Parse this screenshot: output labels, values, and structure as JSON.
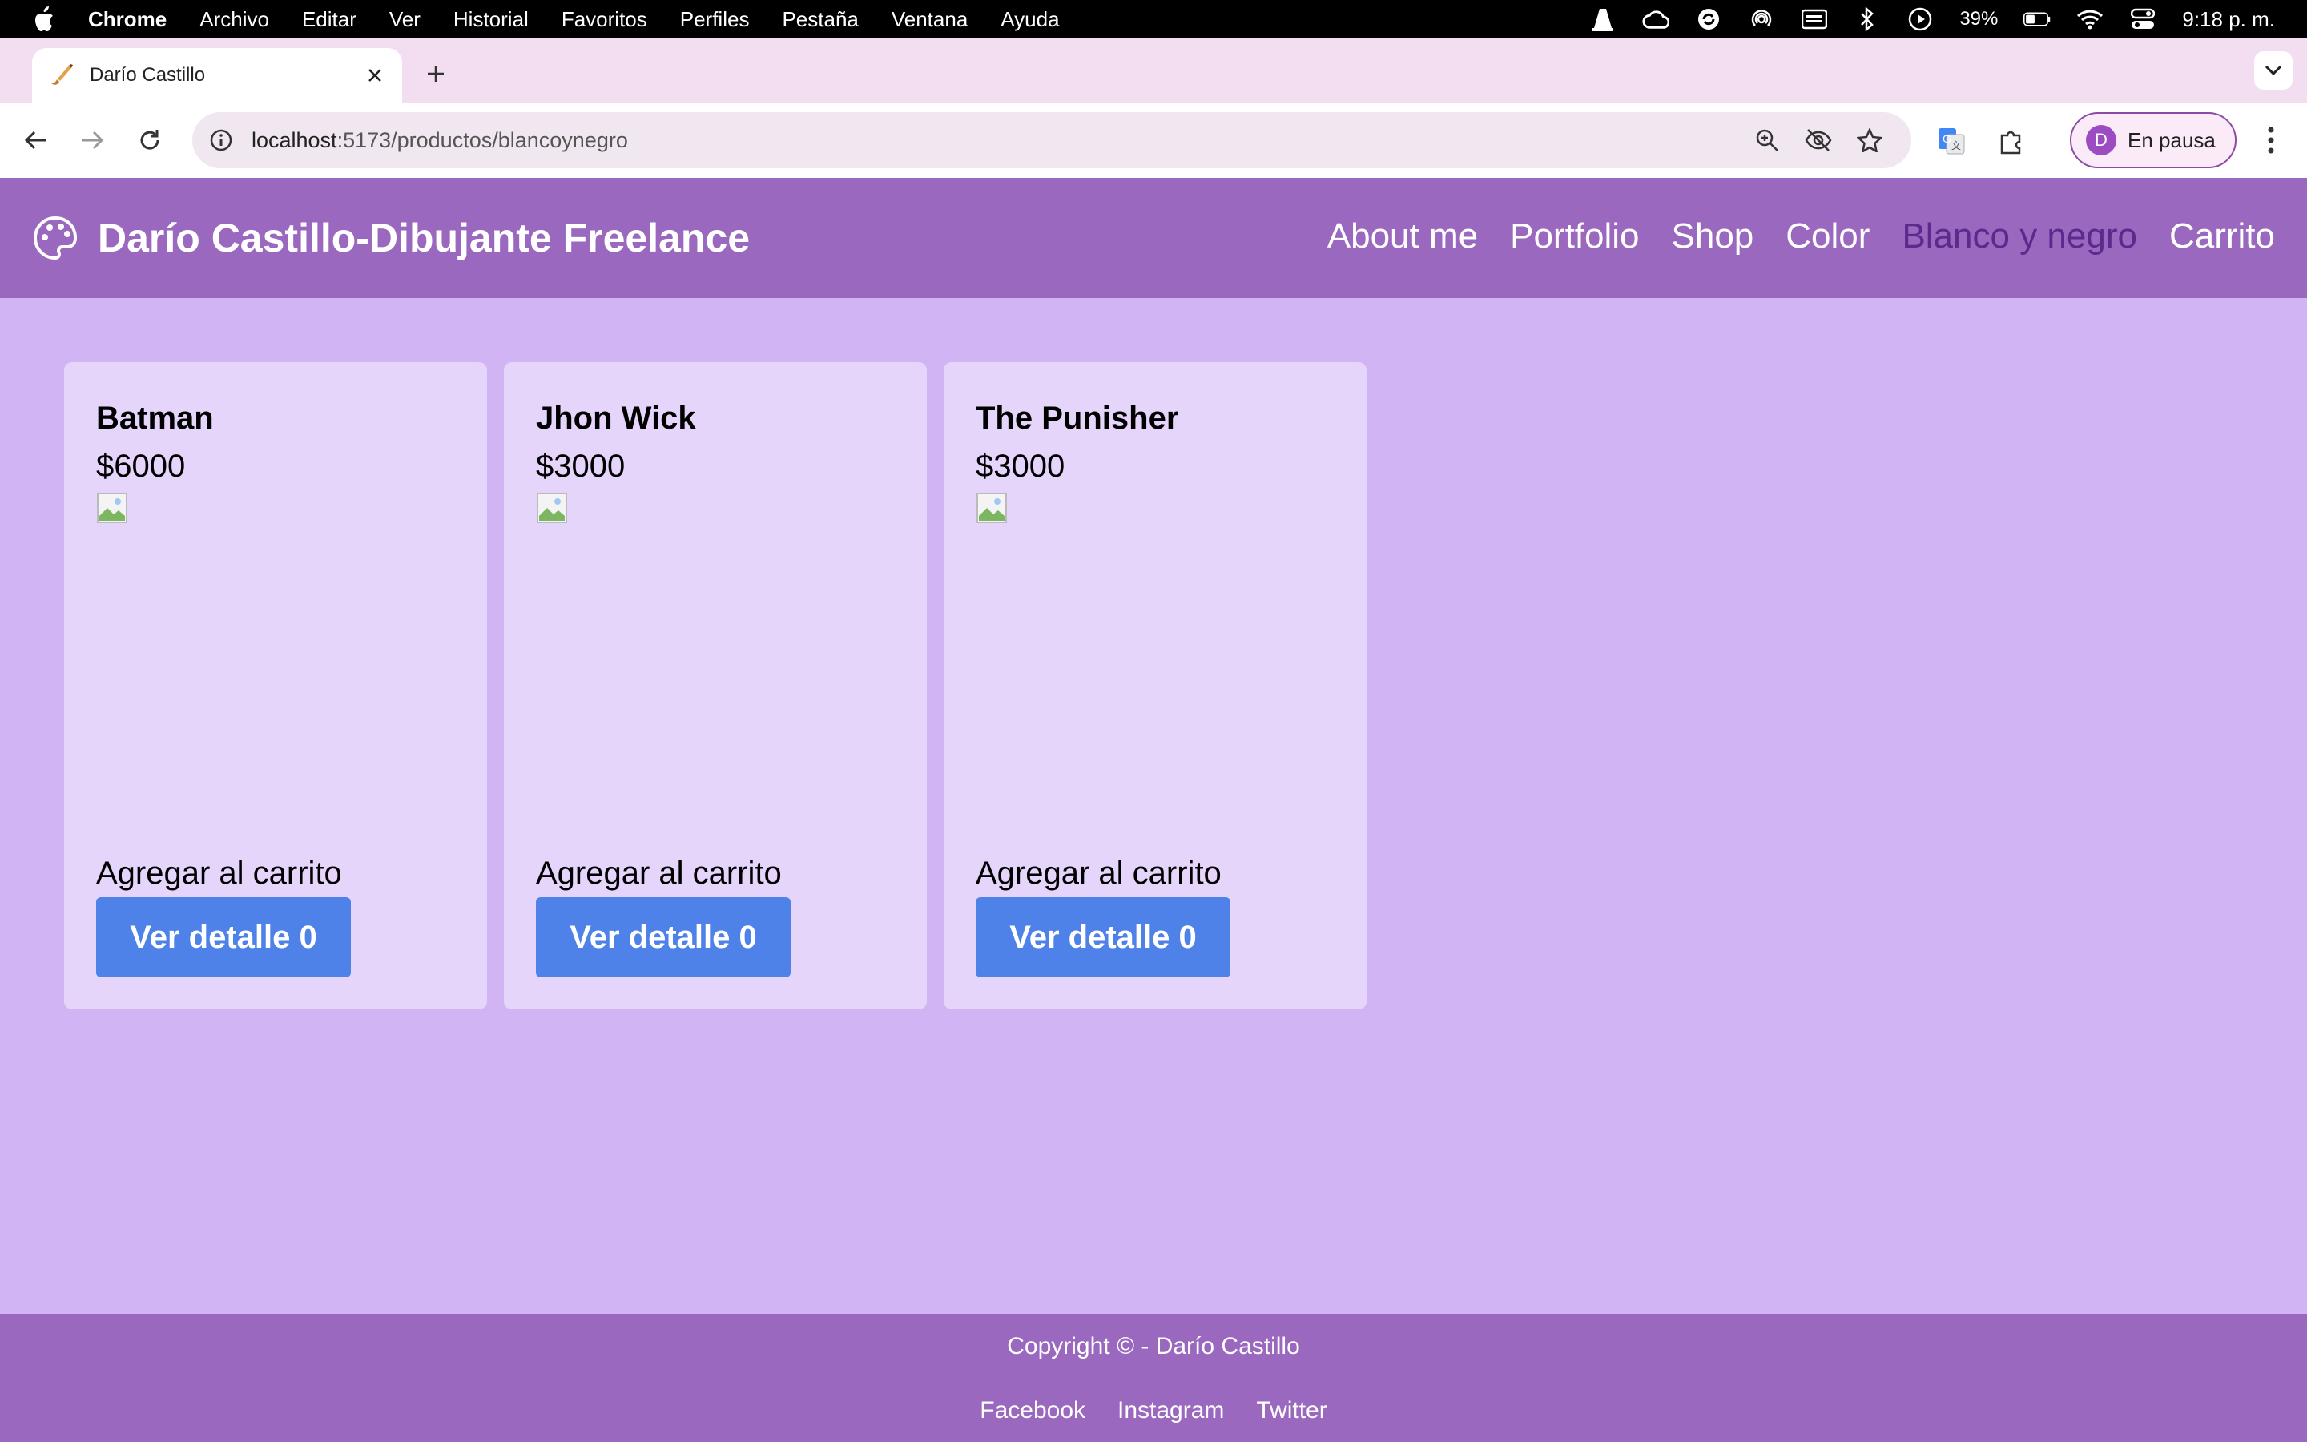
{
  "menubar": {
    "app": "Chrome",
    "items": [
      "Archivo",
      "Editar",
      "Ver",
      "Historial",
      "Favoritos",
      "Perfiles",
      "Pestaña",
      "Ventana",
      "Ayuda"
    ],
    "battery": "39%",
    "clock": "9:18 p. m."
  },
  "tab": {
    "title": "Darío Castillo"
  },
  "toolbar": {
    "url_host": "localhost",
    "url_path": ":5173/productos/blancoynegro",
    "profile_initial": "D",
    "profile_label": "En pausa"
  },
  "site": {
    "title": "Darío Castillo-Dibujante Freelance",
    "nav": [
      "About me",
      "Portfolio",
      "Shop",
      "Color",
      "Blanco y negro",
      "Carrito"
    ],
    "active_nav": "Blanco y negro",
    "accent": "#9a68bf",
    "active_color": "#5a2a8c"
  },
  "products": [
    {
      "name": "Batman",
      "price": "$6000",
      "add": "Agregar al carrito",
      "button": "Ver detalle 0"
    },
    {
      "name": "Jhon Wick",
      "price": "$3000",
      "add": "Agregar al carrito",
      "button": "Ver detalle 0"
    },
    {
      "name": "The Punisher",
      "price": "$3000",
      "add": "Agregar al carrito",
      "button": "Ver detalle 0"
    }
  ],
  "footer": {
    "copyright": "Copyright © - Darío Castillo",
    "links": [
      "Facebook",
      "Instagram",
      "Twitter"
    ]
  }
}
